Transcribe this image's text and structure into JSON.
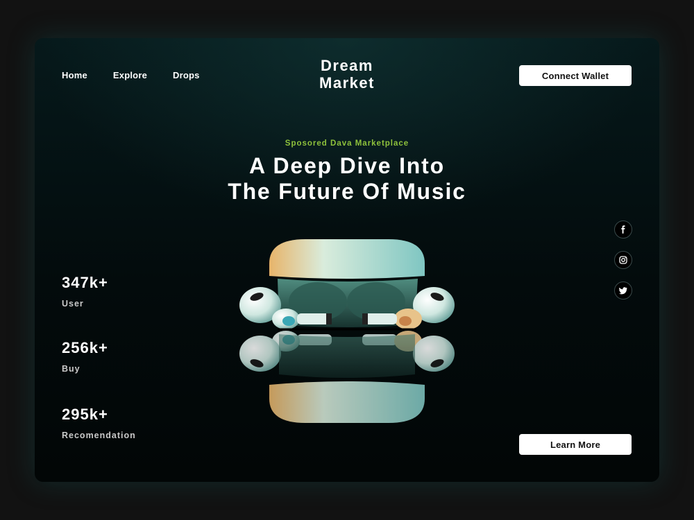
{
  "nav": {
    "items": [
      {
        "label": "Home"
      },
      {
        "label": "Explore"
      },
      {
        "label": "Drops"
      }
    ]
  },
  "logo": {
    "line1": "Dream",
    "line2": "Market"
  },
  "header": {
    "connect_label": "Connect Wallet"
  },
  "hero": {
    "eyebrow": "Sposored Dava Marketplace",
    "title_line1": "A Deep Dive Into",
    "title_line2": "The Future Of Music"
  },
  "stats": [
    {
      "value": "347k+",
      "label": "User"
    },
    {
      "value": "256k+",
      "label": "Buy"
    },
    {
      "value": "295k+",
      "label": "Recomendation"
    }
  ],
  "social": [
    {
      "icon": "facebook-icon"
    },
    {
      "icon": "instagram-icon"
    },
    {
      "icon": "twitter-icon"
    }
  ],
  "cta": {
    "learn_label": "Learn More"
  },
  "colors": {
    "accent": "#8fc23c",
    "background": "#030b0c",
    "button": "#ffffff"
  }
}
